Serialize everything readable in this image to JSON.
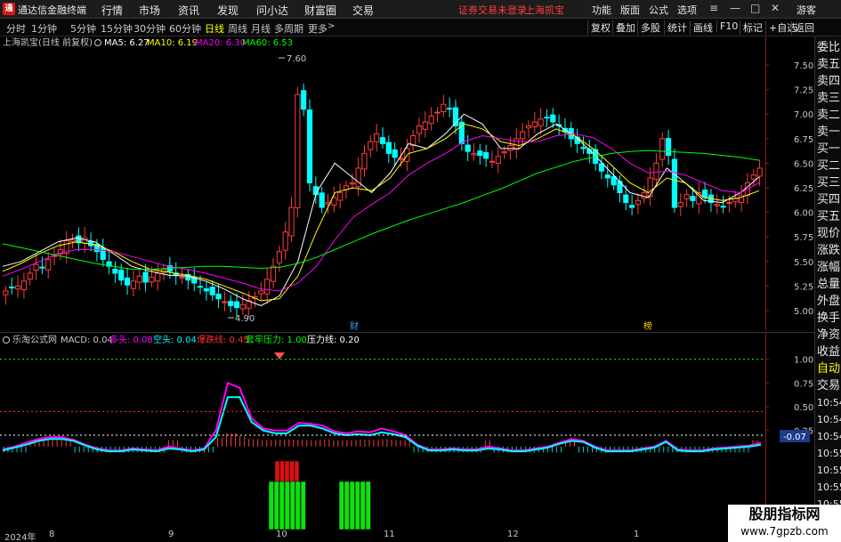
{
  "app": {
    "logo_char": "通",
    "title": "通达信金融终端",
    "menus": [
      "行情",
      "市场",
      "资讯",
      "发现",
      "问小达",
      "财富圈",
      "交易"
    ],
    "login_notice": "证券交易未登录",
    "stock_name_tag": "上海凯宝",
    "title_buttons": [
      "功能",
      "版面",
      "公式",
      "选项"
    ],
    "guest": "游客"
  },
  "toolbar": {
    "periods": [
      "分时",
      "1分钟",
      "5分钟",
      "15分钟",
      "30分钟",
      "60分钟",
      "日线",
      "周线",
      "月线",
      "多周期",
      "更多"
    ],
    "active_period": "日线",
    "right_buttons": [
      "复权",
      "叠加",
      "多股",
      "统计",
      "画线",
      "F10",
      "标记",
      "+自选",
      "返回"
    ]
  },
  "main_chart": {
    "header": {
      "title": "上海凯宝(日线 前复权)",
      "ma": [
        {
          "label": "MA5: 6.27",
          "color": "#ffffff"
        },
        {
          "label": "MA10: 6.19",
          "color": "#ffff00"
        },
        {
          "label": "MA20: 6.30",
          "color": "#ff00ff"
        },
        {
          "label": "MA60: 6.53",
          "color": "#00ff00"
        }
      ]
    },
    "annotations": {
      "high": "7.60",
      "low": "4.90",
      "mark1": "财",
      "mark2": "榜"
    }
  },
  "macd_panel": {
    "header": [
      {
        "label": "乐淘公式网",
        "color": "#c8c8c8"
      },
      {
        "label": "MACD: 0.04",
        "color": "#c8c8c8"
      },
      {
        "label": "多头: 0.08",
        "color": "#ff00ff"
      },
      {
        "label": "空头: 0.04",
        "color": "#00ffff"
      },
      {
        "label": "爆跌线: 0.45",
        "color": "#ff3030"
      },
      {
        "label": "套牢压力: 1.00",
        "color": "#00ff00"
      },
      {
        "label": "压力线: 0.20",
        "color": "#ffffff"
      }
    ],
    "current_value": "-0.07"
  },
  "sidebar": {
    "items": [
      "委比",
      "卖五",
      "卖四",
      "卖三",
      "卖二",
      "卖一",
      "买一",
      "买二",
      "买三",
      "买四",
      "买五",
      "现价",
      "涨跌",
      "涨幅",
      "总量",
      "外盘",
      "换手",
      "净资",
      "收益",
      "自动",
      "交易",
      "10:54",
      "10:54",
      "10:54",
      "10:55",
      "10:55",
      "10:55",
      "10:55",
      "10:55"
    ]
  },
  "xaxis": {
    "labels": [
      "2024年",
      "8",
      "9",
      "10",
      "11",
      "12",
      "1"
    ]
  },
  "watermark": {
    "line1": "股朋指标网",
    "line2": "www.7gpzb.com"
  },
  "colors": {
    "up": "#ff3c3c",
    "down": "#00ffff",
    "ma5": "#ffffff",
    "ma10": "#ffff00",
    "ma20": "#ff00ff",
    "ma60": "#00ff00"
  },
  "chart_data": [
    {
      "type": "candlestick",
      "title": "上海凯宝(日线 前复权)",
      "ylim": [
        4.8,
        7.7
      ],
      "yticks": [
        5.0,
        5.25,
        5.5,
        5.75,
        6.0,
        6.25,
        6.5,
        6.75,
        7.0,
        7.25,
        7.5
      ],
      "ytick_labels": [
        "5.00",
        "5.25",
        "5.50",
        "5.75",
        "6.00",
        "6.25",
        "6.50",
        "6.75",
        "7.00",
        "7.25",
        "7.50"
      ],
      "x_month_labels": [
        "2024年",
        "8",
        "9",
        "10",
        "11",
        "12",
        "1"
      ],
      "close_by_day": [
        5.2,
        5.23,
        5.25,
        5.3,
        5.38,
        5.47,
        5.44,
        5.52,
        5.56,
        5.62,
        5.71,
        5.72,
        5.69,
        5.74,
        5.66,
        5.6,
        5.52,
        5.45,
        5.38,
        5.31,
        5.26,
        5.3,
        5.35,
        5.29,
        5.34,
        5.38,
        5.42,
        5.4,
        5.36,
        5.34,
        5.31,
        5.28,
        5.24,
        5.2,
        5.16,
        5.12,
        5.09,
        5.05,
        5.03,
        5.06,
        5.1,
        5.14,
        5.2,
        5.32,
        5.45,
        5.6,
        5.8,
        6.05,
        7.2,
        7.05,
        6.3,
        6.18,
        6.05,
        6.1,
        6.15,
        6.2,
        6.27,
        6.3,
        6.45,
        6.6,
        6.72,
        6.8,
        6.7,
        6.6,
        6.56,
        6.55,
        6.65,
        6.78,
        6.88,
        6.92,
        6.98,
        7.02,
        7.1,
        7.06,
        6.88,
        6.7,
        6.62,
        6.6,
        6.58,
        6.55,
        6.52,
        6.57,
        6.62,
        6.68,
        6.75,
        6.82,
        6.88,
        6.92,
        6.95,
        6.96,
        6.92,
        6.88,
        6.82,
        6.75,
        6.7,
        6.65,
        6.6,
        6.5,
        6.42,
        6.35,
        6.28,
        6.2,
        6.1,
        6.05,
        6.12,
        6.2,
        6.35,
        6.5,
        6.75,
        6.58,
        6.05,
        6.1,
        6.18,
        6.12,
        6.2,
        6.15,
        6.1,
        6.08,
        6.06,
        6.1,
        6.14,
        6.17,
        6.3,
        6.38,
        6.45
      ],
      "ma_series": {
        "MA5": [
          5.45,
          5.5,
          5.6,
          5.7,
          5.74,
          5.7,
          5.58,
          5.45,
          5.4,
          5.36,
          5.35,
          5.3,
          5.22,
          5.12,
          5.05,
          5.15,
          5.5,
          6.2,
          6.5,
          6.35,
          6.2,
          6.4,
          6.7,
          6.65,
          6.8,
          7.0,
          6.9,
          6.65,
          6.65,
          6.8,
          6.9,
          6.78,
          6.6,
          6.4,
          6.2,
          6.15,
          6.45,
          6.3,
          6.12,
          6.1,
          6.2,
          6.36
        ],
        "MA10": [
          5.4,
          5.48,
          5.58,
          5.66,
          5.7,
          5.67,
          5.6,
          5.5,
          5.42,
          5.39,
          5.36,
          5.32,
          5.25,
          5.18,
          5.1,
          5.12,
          5.35,
          5.8,
          6.2,
          6.25,
          6.22,
          6.35,
          6.6,
          6.65,
          6.75,
          6.9,
          6.85,
          6.72,
          6.68,
          6.75,
          6.85,
          6.78,
          6.65,
          6.48,
          6.3,
          6.2,
          6.35,
          6.3,
          6.15,
          6.12,
          6.15,
          6.22
        ],
        "MA20": [
          5.35,
          5.42,
          5.5,
          5.58,
          5.62,
          5.62,
          5.6,
          5.55,
          5.5,
          5.45,
          5.42,
          5.38,
          5.33,
          5.28,
          5.22,
          5.2,
          5.28,
          5.45,
          5.72,
          5.95,
          6.08,
          6.2,
          6.38,
          6.5,
          6.6,
          6.72,
          6.78,
          6.75,
          6.72,
          6.72,
          6.78,
          6.8,
          6.76,
          6.65,
          6.5,
          6.4,
          6.42,
          6.38,
          6.3,
          6.22,
          6.2,
          6.3
        ],
        "MA60": [
          5.68,
          5.64,
          5.6,
          5.56,
          5.52,
          5.48,
          5.45,
          5.42,
          5.42,
          5.43,
          5.44,
          5.45,
          5.45,
          5.44,
          5.43,
          5.44,
          5.48,
          5.54,
          5.62,
          5.7,
          5.78,
          5.85,
          5.92,
          5.98,
          6.04,
          6.1,
          6.17,
          6.24,
          6.32,
          6.4,
          6.46,
          6.52,
          6.56,
          6.6,
          6.62,
          6.63,
          6.62,
          6.61,
          6.6,
          6.58,
          6.56,
          6.53
        ]
      }
    },
    {
      "type": "line",
      "title": "MACD",
      "ylim": [
        -0.1,
        1.1
      ],
      "yticks": [
        1.0,
        0.75,
        0.5,
        0.25
      ],
      "ytick_labels": [
        "1.00",
        "0.75",
        "0.50",
        "0.25"
      ],
      "hlines": [
        {
          "y": 1.0,
          "color": "#00ff00"
        },
        {
          "y": 0.45,
          "color": "#ff3030"
        },
        {
          "y": 0.2,
          "color": "#ffffff"
        }
      ],
      "series": [
        {
          "name": "多头",
          "color": "#ff00ff",
          "values": [
            0.05,
            0.08,
            0.12,
            0.16,
            0.18,
            0.18,
            0.15,
            0.1,
            0.06,
            0.04,
            0.04,
            0.06,
            0.05,
            0.04,
            0.08,
            0.06,
            0.04,
            0.06,
            0.25,
            0.75,
            0.7,
            0.38,
            0.27,
            0.25,
            0.25,
            0.33,
            0.32,
            0.3,
            0.24,
            0.22,
            0.24,
            0.23,
            0.27,
            0.24,
            0.2,
            0.1,
            0.05,
            0.05,
            0.06,
            0.05,
            0.05,
            0.08,
            0.06,
            0.04,
            0.04,
            0.06,
            0.08,
            0.12,
            0.16,
            0.14,
            0.08,
            0.04,
            0.04,
            0.04,
            0.06,
            0.08,
            0.14,
            0.05,
            0.04,
            0.04,
            0.06,
            0.07,
            0.08,
            0.09,
            0.12
          ]
        },
        {
          "name": "空头",
          "color": "#00ffff",
          "values": [
            0.04,
            0.07,
            0.1,
            0.14,
            0.16,
            0.16,
            0.14,
            0.09,
            0.05,
            0.03,
            0.03,
            0.05,
            0.04,
            0.03,
            0.06,
            0.05,
            0.03,
            0.05,
            0.18,
            0.6,
            0.6,
            0.34,
            0.25,
            0.22,
            0.22,
            0.3,
            0.3,
            0.27,
            0.22,
            0.2,
            0.21,
            0.2,
            0.23,
            0.21,
            0.18,
            0.09,
            0.04,
            0.04,
            0.05,
            0.04,
            0.04,
            0.06,
            0.05,
            0.03,
            0.03,
            0.05,
            0.07,
            0.11,
            0.14,
            0.13,
            0.07,
            0.03,
            0.03,
            0.03,
            0.05,
            0.07,
            0.13,
            0.04,
            0.03,
            0.03,
            0.05,
            0.06,
            0.07,
            0.08,
            0.1
          ]
        }
      ]
    }
  ]
}
